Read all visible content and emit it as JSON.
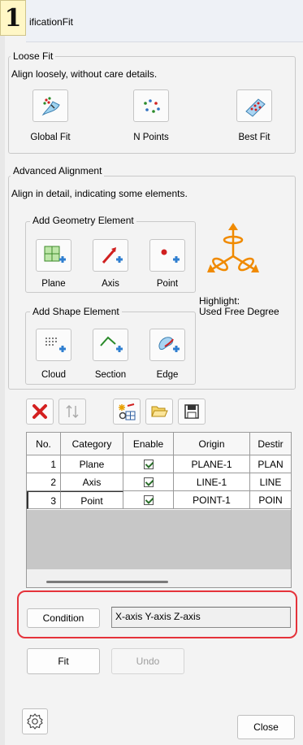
{
  "badge": "1",
  "window": {
    "title": "ificationFit"
  },
  "loose_fit": {
    "legend": "Loose Fit",
    "description": "Align loosely, without care details.",
    "buttons": [
      {
        "label": "Global Fit",
        "icon": "global-fit-icon"
      },
      {
        "label": "N Points",
        "icon": "n-points-icon"
      },
      {
        "label": "Best Fit",
        "icon": "best-fit-icon"
      }
    ]
  },
  "advanced": {
    "legend": "Advanced Alignment",
    "description": "Align in detail, indicating some elements.",
    "geometry": {
      "legend": "Add Geometry Element",
      "buttons": [
        {
          "label": "Plane",
          "icon": "plane-add-icon"
        },
        {
          "label": "Axis",
          "icon": "axis-add-icon"
        },
        {
          "label": "Point",
          "icon": "point-add-icon"
        }
      ]
    },
    "shape": {
      "legend": "Add Shape Element",
      "buttons": [
        {
          "label": "Cloud",
          "icon": "cloud-add-icon"
        },
        {
          "label": "Section",
          "icon": "section-add-icon"
        },
        {
          "label": "Edge",
          "icon": "edge-add-icon"
        }
      ]
    },
    "highlight": {
      "line1": "Highlight:",
      "line2": "Used Free Degree",
      "icon": "free-degree-icon"
    }
  },
  "toolbar": [
    "delete-icon",
    "sort-icon",
    "table-settings-icon",
    "open-folder-icon",
    "save-icon"
  ],
  "table": {
    "columns": [
      "No.",
      "Category",
      "Enable",
      "Origin",
      "Destir"
    ],
    "rows": [
      {
        "no": "1",
        "category": "Plane",
        "enabled": true,
        "origin": "PLANE-1",
        "dest": "PLAN"
      },
      {
        "no": "2",
        "category": "Axis",
        "enabled": true,
        "origin": "LINE-1",
        "dest": "LINE"
      },
      {
        "no": "3",
        "category": "Point",
        "enabled": true,
        "origin": "POINT-1",
        "dest": "POIN"
      }
    ]
  },
  "condition": {
    "button": "Condition",
    "value": "X-axis Y-axis Z-axis"
  },
  "actions": {
    "fit": "Fit",
    "undo": "Undo"
  },
  "footer": {
    "close": "Close",
    "settings_icon": "gear-icon"
  },
  "colors": {
    "highlight_box": "#e5333b",
    "arrow_orange": "#f08a00",
    "delete_red": "#d42020"
  }
}
